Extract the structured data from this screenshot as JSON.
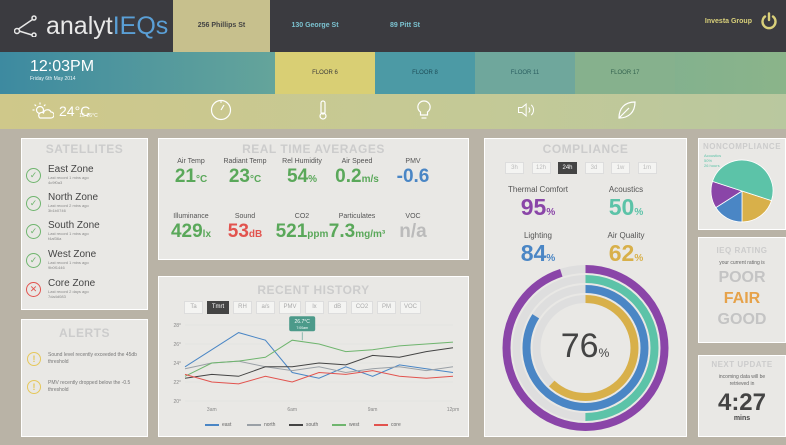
{
  "header": {
    "brand_prefix": "analyt",
    "brand_suffix": "IEQs",
    "tabs": [
      "256 Phillips St",
      "130 George St",
      "89 Pitt St"
    ],
    "user": "Investa Group",
    "power_icon": "power-icon"
  },
  "clock": {
    "time": "12:03PM",
    "date": "Friday 6th May 2014"
  },
  "floors": [
    "FLOOR 6",
    "FLOOR 8",
    "FLOOR 11",
    "FLOOR 17"
  ],
  "weather": {
    "temp": "24°C",
    "sub": "15-26°C",
    "icon": "partly-sunny-icon"
  },
  "room_icons": [
    "gauge-icon",
    "thermometer-icon",
    "lightbulb-icon",
    "speaker-icon",
    "leaf-icon"
  ],
  "satellites": {
    "title": "SATELLITES",
    "zones": [
      {
        "name": "East Zone",
        "sub": "Last record 1 mins ago",
        "id": "4c9f0a3",
        "status": "ok"
      },
      {
        "name": "North Zone",
        "sub": "Last record 2 mins ago",
        "id": "3b1b0746",
        "status": "ok"
      },
      {
        "name": "South Zone",
        "sub": "Last record 1 mins ago",
        "id": "f4af36a",
        "status": "ok"
      },
      {
        "name": "West Zone",
        "sub": "Last record 1 mins ago",
        "id": "9b0f1446",
        "status": "ok"
      },
      {
        "name": "Core Zone",
        "sub": "Last record 2 days ago",
        "id": "7da4d083",
        "status": "error"
      }
    ]
  },
  "alerts": {
    "title": "ALERTS",
    "items": [
      "Sound level recently exceeded the 45db threshold",
      "PMV recently dropped below the -0.5 threshold"
    ]
  },
  "averages": {
    "title": "REAL TIME AVERAGES",
    "row1": [
      {
        "label": "Air Temp",
        "value": "21",
        "unit": "°C",
        "color": "#5aa85a"
      },
      {
        "label": "Radiant Temp",
        "value": "23",
        "unit": "°C",
        "color": "#5aa85a"
      },
      {
        "label": "Rel Humidity",
        "value": "54",
        "unit": "%",
        "color": "#5aa85a"
      },
      {
        "label": "Air Speed",
        "value": "0.2",
        "unit": "m/s",
        "color": "#5aa85a"
      },
      {
        "label": "PMV",
        "value": "-0.6",
        "unit": "",
        "color": "#4a86c5"
      }
    ],
    "row2": [
      {
        "label": "Illuminance",
        "value": "429",
        "unit": "lx",
        "color": "#5aa85a"
      },
      {
        "label": "Sound",
        "value": "53",
        "unit": "dB",
        "color": "#e2534e"
      },
      {
        "label": "CO2",
        "value": "521",
        "unit": "ppm",
        "color": "#5aa85a"
      },
      {
        "label": "Particulates",
        "value": "7.3",
        "unit": "mg/m³",
        "color": "#5aa85a"
      },
      {
        "label": "VOC",
        "value": "n/a",
        "unit": "",
        "color": "#bbbbbb"
      }
    ]
  },
  "history": {
    "title": "RECENT HISTORY",
    "buttons": [
      "Ta",
      "Tmrt",
      "RH",
      "a/s",
      "PMV",
      "lx",
      "dB",
      "CO2",
      "PM",
      "VOC"
    ],
    "active": "Tmrt",
    "tooltip": "26.7°C",
    "tooltip_sub": "7:00am",
    "y_ticks": [
      "28°",
      "26°",
      "24°",
      "22°",
      "20°"
    ],
    "x_ticks": [
      "3am",
      "6am",
      "9am",
      "12pm"
    ],
    "legend": [
      "east",
      "north",
      "south",
      "west",
      "core"
    ],
    "colors": {
      "east": "#4a86c5",
      "north": "#9aa0a6",
      "south": "#444444",
      "west": "#6fb56e",
      "core": "#e2534e"
    }
  },
  "chart_data": {
    "type": "line",
    "x": [
      "2am",
      "3am",
      "4am",
      "5am",
      "6am",
      "7am",
      "8am",
      "9am",
      "10am",
      "11am",
      "12pm"
    ],
    "ylim": [
      20,
      28
    ],
    "series": [
      {
        "name": "east",
        "values": [
          23.6,
          25.4,
          27.2,
          26.4,
          23.0,
          22.4,
          23.6,
          22.6,
          23.8,
          23.4,
          23.0
        ]
      },
      {
        "name": "north",
        "values": [
          23.4,
          24.0,
          24.2,
          23.6,
          23.2,
          23.6,
          23.0,
          23.4,
          23.6,
          23.2,
          23.6
        ]
      },
      {
        "name": "south",
        "values": [
          22.4,
          22.8,
          22.6,
          23.6,
          23.6,
          24.0,
          23.8,
          24.8,
          24.6,
          25.2,
          25.6
        ]
      },
      {
        "name": "west",
        "values": [
          22.6,
          24.0,
          24.2,
          24.6,
          26.4,
          26.0,
          25.2,
          25.4,
          25.8,
          26.0,
          26.2
        ]
      },
      {
        "name": "core",
        "values": [
          22.8,
          22.0,
          21.8,
          22.6,
          22.0,
          23.0,
          22.8,
          23.2,
          22.6,
          22.4,
          22.6
        ]
      }
    ]
  },
  "compliance": {
    "title": "COMPLIANCE",
    "ranges": [
      "3h",
      "12h",
      "24h",
      "3d",
      "1w",
      "1m"
    ],
    "active": "24h",
    "metrics": [
      {
        "label": "Thermal Comfort",
        "value": "95",
        "color": "#8a45a8"
      },
      {
        "label": "Acoustics",
        "value": "50",
        "color": "#5cc3a8"
      },
      {
        "label": "Lighting",
        "value": "84",
        "color": "#4a86c5"
      },
      {
        "label": "Air Quality",
        "value": "62",
        "color": "#d8b04a"
      }
    ],
    "overall": "76",
    "unit": "%"
  },
  "noncompliance": {
    "title": "NONCOMPLIANCE",
    "labels": [
      "Acoustics",
      "50%",
      "26 hours"
    ],
    "slices": [
      {
        "label": "Acoustics",
        "value": 50,
        "color": "#5cc3a8"
      },
      {
        "label": "Air Quality",
        "value": 20,
        "color": "#d8b04a"
      },
      {
        "label": "Lighting",
        "value": 16,
        "color": "#4a86c5"
      },
      {
        "label": "Thermal Comfort",
        "value": 14,
        "color": "#8a45a8"
      }
    ]
  },
  "rating": {
    "title": "IEQ RATING",
    "sub": "your current rating is",
    "levels": [
      "POOR",
      "FAIR",
      "GOOD"
    ],
    "active": "FAIR"
  },
  "next_update": {
    "title": "NEXT UPDATE",
    "sub": "incoming data will be retrieved in",
    "time": "4:27",
    "unit": "mins"
  }
}
